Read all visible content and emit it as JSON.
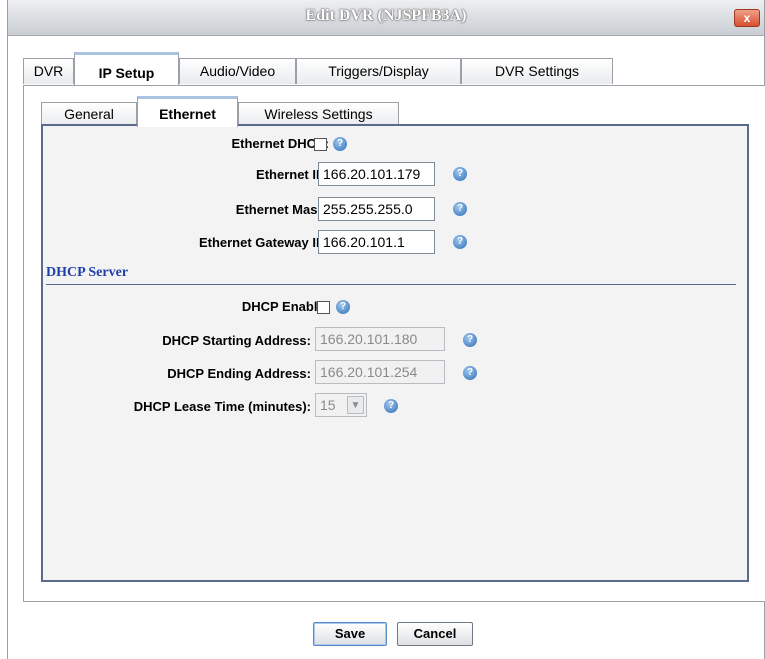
{
  "window": {
    "title": "Edit DVR (NJSPFB3A)",
    "close_glyph": "x"
  },
  "main_tabs": [
    {
      "label": "DVR"
    },
    {
      "label": "IP Setup"
    },
    {
      "label": "Audio/Video"
    },
    {
      "label": "Triggers/Display"
    },
    {
      "label": "DVR Settings"
    }
  ],
  "sub_tabs": [
    {
      "label": "General"
    },
    {
      "label": "Ethernet"
    },
    {
      "label": "Wireless Settings"
    }
  ],
  "ethernet": {
    "dhcp_label": "Ethernet DHCP:",
    "ip_label": "Ethernet IP:",
    "ip_value": "166.20.101.179",
    "mask_label": "Ethernet Mask:",
    "mask_value": "255.255.255.0",
    "gateway_label": "Ethernet Gateway IP:",
    "gateway_value": "166.20.101.1"
  },
  "dhcp_server": {
    "section_title": "DHCP Server",
    "enable_label": "DHCP Enable:",
    "start_label": "DHCP Starting Address:",
    "start_value": "166.20.101.180",
    "end_label": "DHCP Ending Address:",
    "end_value": "166.20.101.254",
    "lease_label": "DHCP Lease Time (minutes):",
    "lease_value": "15"
  },
  "buttons": {
    "save": "Save",
    "cancel": "Cancel"
  },
  "icons": {
    "help": "help-icon",
    "dropdown": "chevron-down-icon"
  },
  "colors": {
    "section_title": "#1f3fa8",
    "help_icon": "#2f6db5",
    "frame_border": "#5a6a8c"
  }
}
